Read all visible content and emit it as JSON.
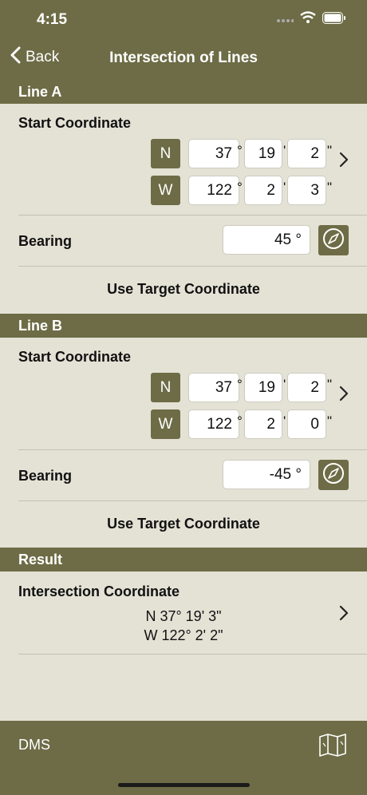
{
  "status": {
    "time": "4:15"
  },
  "nav": {
    "back_label": "Back",
    "title": "Intersection of Lines"
  },
  "line_a": {
    "header": "Line A",
    "start_label": "Start Coordinate",
    "lat": {
      "hemisphere": "N",
      "deg": "37",
      "min": "19",
      "sec": "2"
    },
    "lon": {
      "hemisphere": "W",
      "deg": "122",
      "min": "2",
      "sec": "3"
    },
    "bearing_label": "Bearing",
    "bearing_value": "45 °",
    "target_button": "Use Target Coordinate"
  },
  "line_b": {
    "header": "Line B",
    "start_label": "Start Coordinate",
    "lat": {
      "hemisphere": "N",
      "deg": "37",
      "min": "19",
      "sec": "2"
    },
    "lon": {
      "hemisphere": "W",
      "deg": "122",
      "min": "2",
      "sec": "0"
    },
    "bearing_label": "Bearing",
    "bearing_value": "-45 °",
    "target_button": "Use Target Coordinate"
  },
  "units": {
    "deg": "°",
    "min": "'",
    "sec": "\""
  },
  "result": {
    "header": "Result",
    "label": "Intersection Coordinate",
    "lat": "N 37° 19' 3\"",
    "lon": "W 122° 2' 2\""
  },
  "footer": {
    "format_label": "DMS"
  },
  "colors": {
    "accent": "#6d6c46",
    "background": "#e4e2d5",
    "field": "#ffffff"
  },
  "icons": [
    "wifi-icon",
    "battery-icon",
    "chevron-left-icon",
    "chevron-right-icon",
    "compass-icon",
    "map-icon"
  ]
}
